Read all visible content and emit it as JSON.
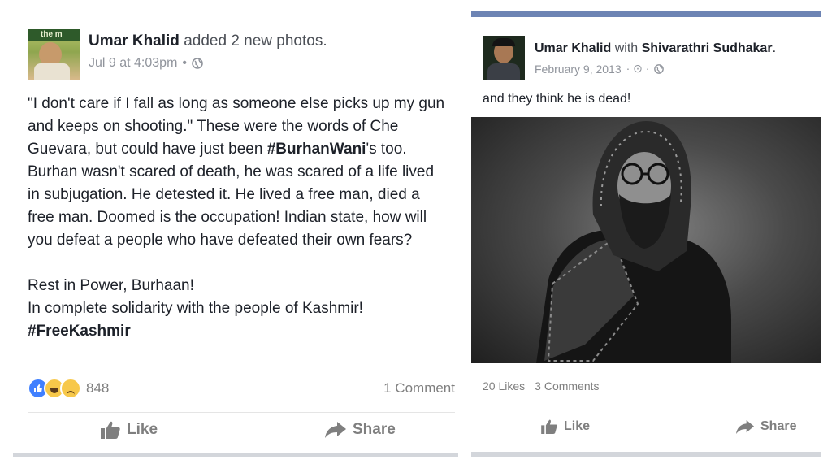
{
  "left_post": {
    "author": "Umar Khalid",
    "action": "added 2 new photos.",
    "timestamp": "Jul 9 at 4:03pm",
    "separator": "•",
    "body": {
      "p1_a": "\"I don't care if I fall as long as someone else picks up my gun and keeps on shooting.\" These were the words of Che Guevara, but could have just been ",
      "p1_hashtag": "#BurhanWani",
      "p1_b": "'s too. Burhan wasn't scared of death, he was scared of a life lived in subjugation. He detested it. He lived a free man, died a free man. Doomed is the occupation! Indian state, how will you defeat a people who have defeated their own fears?",
      "p2_line1": "Rest in Power, Burhaan!",
      "p2_line2": "In complete solidarity with the people of Kashmir!",
      "p2_hashtag": "#FreeKashmir"
    },
    "reactions_count": "848",
    "comments": "1 Comment",
    "like_label": "Like",
    "share_label": "Share",
    "avatar_banner_text": "the m"
  },
  "right_post": {
    "author": "Umar Khalid",
    "with_word": "with",
    "tagged": "Shivarathri Sudhakar",
    "period": ".",
    "timestamp": "February 9, 2013",
    "meta_separators": "· ⊙ ·",
    "body": "and they think he is dead!",
    "likes": "20 Likes",
    "comments": "3 Comments",
    "like_label": "Like",
    "share_label": "Share"
  },
  "colors": {
    "text": "#1d2129",
    "meta": "#90949c",
    "action_gray": "#7f7f7f",
    "like_blue": "#4080ff",
    "haha_yellow": "#f7c84a",
    "accent_bar": "#6d84b4"
  }
}
